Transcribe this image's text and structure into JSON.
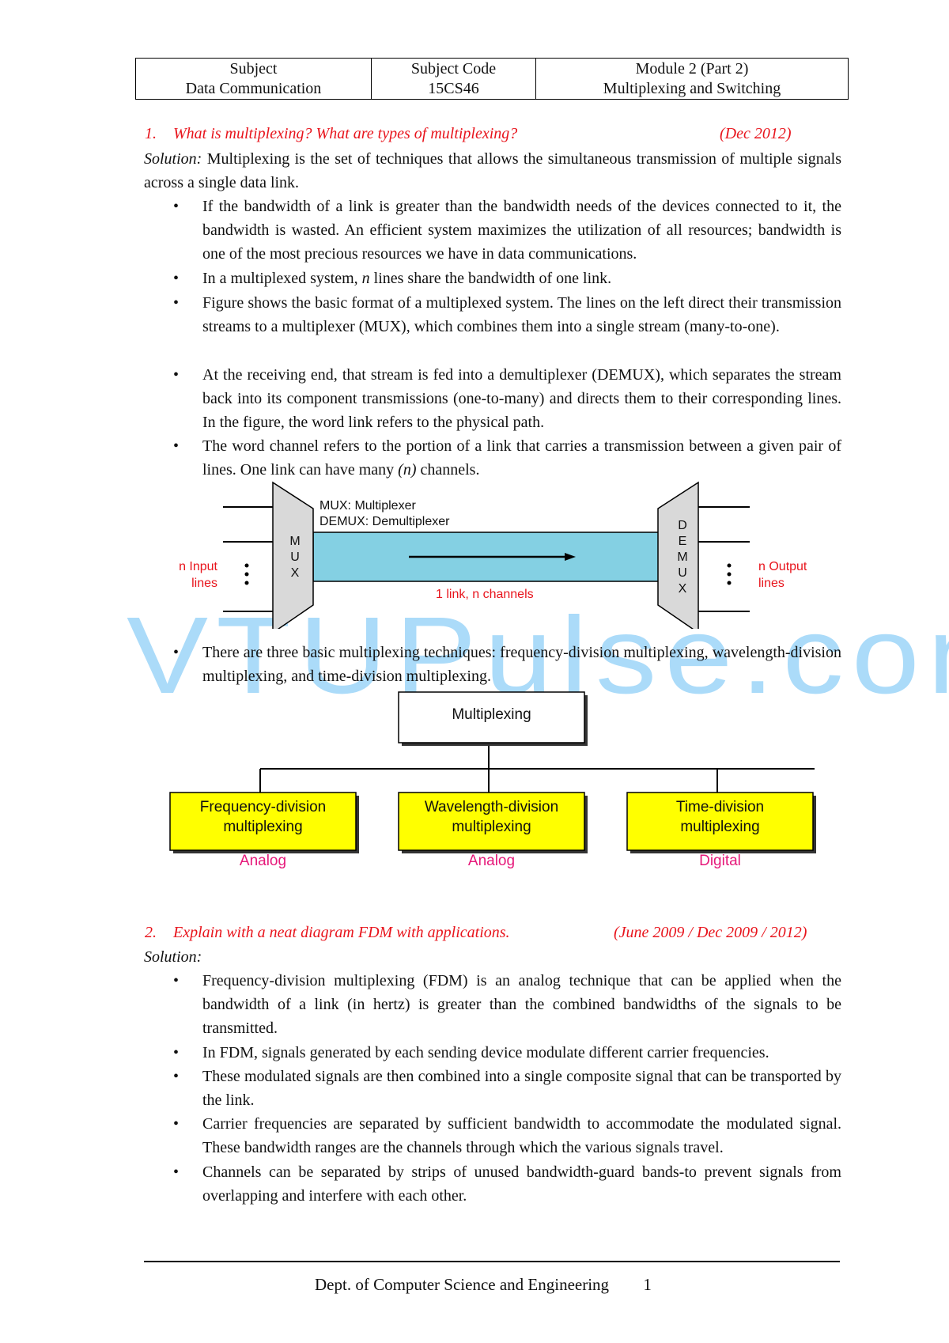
{
  "header": {
    "col1_label": "Subject",
    "col1_value": "Data Communication",
    "col2_label": "Subject Code",
    "col2_value": "15CS46",
    "col3_label": "Module 2 (Part 2)",
    "col3_value": "Multiplexing and Switching"
  },
  "q1": {
    "number": "1.",
    "question": "What is multiplexing? What are types of multiplexing?",
    "date": "(Dec 2012)",
    "solution_label": "Solution:",
    "solution_text": " Multiplexing is the set of techniques that allows the simultaneous transmission of multiple signals across a single data link.",
    "bullets": [
      "If the bandwidth of a link is greater than the bandwidth needs of the devices connected to it, the bandwidth is wasted. An efficient system maximizes the utilization of all resources; bandwidth is one of the most precious resources we have in data communications.",
      "In a multiplexed system, n lines share the bandwidth of one link.",
      "Figure shows the basic format of a multiplexed system. The lines on the left direct their transmission streams to a multiplexer (MUX), which combines them into a single stream (many-to-one).",
      " At the receiving end, that stream is fed into a demultiplexer (DEMUX), which separates the stream back into its component transmissions (one-to-many) and directs them to their corresponding lines. In the figure, the word link refers to the physical path.",
      "The word channel refers to the portion of a link that carries a transmission between a given pair of lines. One link can have many (n) channels.",
      "There are three basic multiplexing techniques: frequency-division multiplexing, wavelength-division multiplexing, and time-division multiplexing."
    ],
    "bullet2_parts": [
      "In a multiplexed system, ",
      "n",
      " lines share the bandwidth of one link."
    ],
    "bullet5_parts": [
      "The word channel refers to the portion of a link that carries a transmission between a given pair of lines. One link can have many ",
      "(n)",
      " channels."
    ]
  },
  "mux_diagram": {
    "legend_line1": "MUX: Multiplexer",
    "legend_line2": "DEMUX: Demultiplexer",
    "mux_letters": [
      "M",
      "U",
      "X"
    ],
    "demux_letters": [
      "D",
      "E",
      "M",
      "U",
      "X"
    ],
    "input_label_1": "n Input",
    "input_label_2": "lines",
    "output_label_1": "n Output",
    "output_label_2": "lines",
    "link_label": "1 link, n channels",
    "colors": {
      "link": "#84d0e3",
      "device": "#d9d9d9",
      "label": "#e8141c"
    }
  },
  "tree_diagram": {
    "root": "Multiplexing",
    "children": [
      {
        "line1": "Frequency-division",
        "line2": "multiplexing",
        "type": "Analog"
      },
      {
        "line1": "Wavelength-division",
        "line2": "multiplexing",
        "type": "Analog"
      },
      {
        "line1": "Time-division",
        "line2": "multiplexing",
        "type": "Digital"
      }
    ],
    "colors": {
      "child_fill": "#ffff00",
      "type_label": "#e6197a"
    }
  },
  "q2": {
    "number": "2.",
    "question": "Explain with a neat diagram FDM with applications.",
    "date": "(June 2009 / Dec 2009 / 2012)",
    "solution_label": "Solution:",
    "bullets": [
      "Frequency-division multiplexing (FDM) is an analog technique that can be applied when the bandwidth of a link (in hertz) is greater than the combined bandwidths of the signals to be transmitted.",
      "In FDM, signals generated by each sending device modulate different carrier frequencies.",
      "These modulated signals are then combined into a single composite signal that can be transported by the link.",
      "Carrier frequencies are separated by sufficient bandwidth to accommodate the modulated signal. These bandwidth ranges are the channels through which the various signals travel.",
      "Channels can be separated by strips of unused bandwidth-guard bands-to prevent signals from overlapping and interfere with each other."
    ]
  },
  "watermark": "VTUPulse.com",
  "footer": {
    "department": "Dept. of Computer Science and Engineering",
    "page_number": "1"
  }
}
